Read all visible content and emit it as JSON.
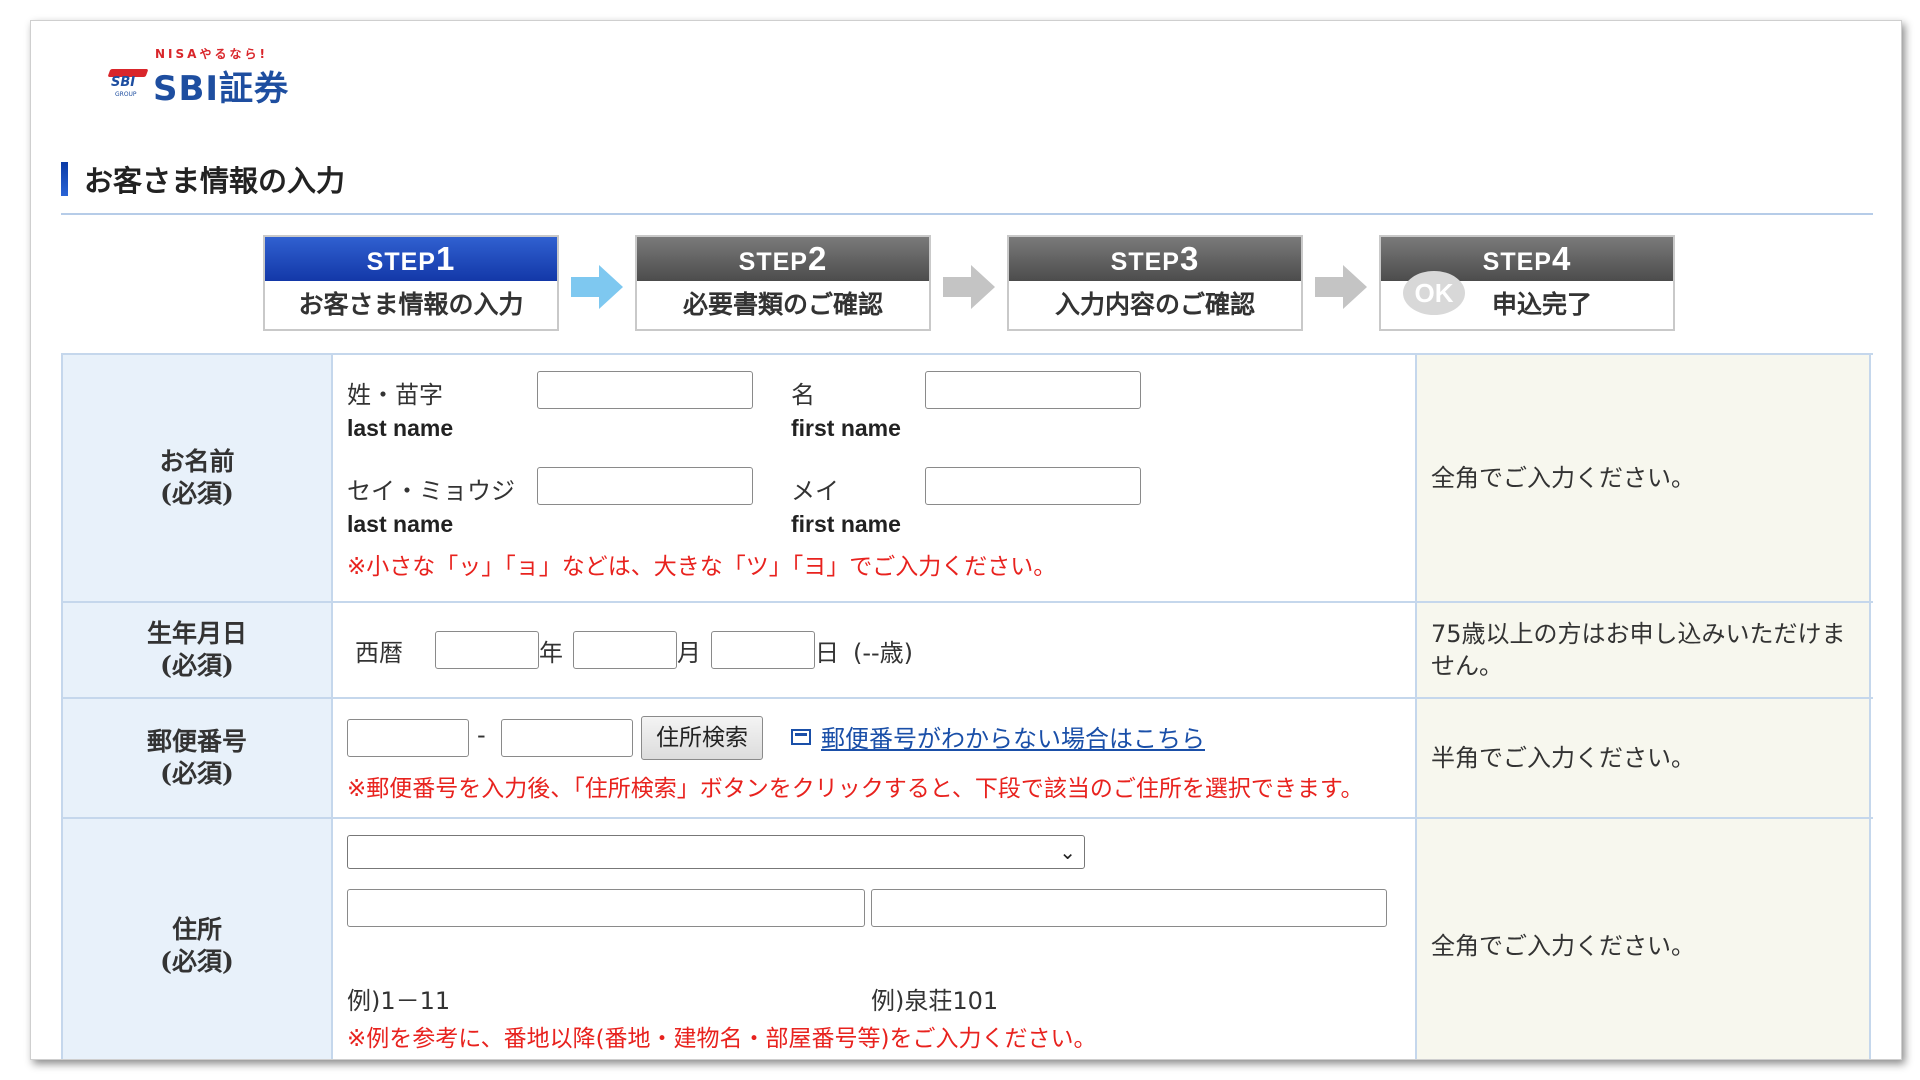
{
  "logo": {
    "tagline": "NISAやるなら!",
    "mark_text": "SBI",
    "group_text": "GROUP",
    "name": "SBI証券"
  },
  "section": {
    "title": "お客さま情報の入力"
  },
  "steps": [
    {
      "prefix": "STEP",
      "num": "1",
      "label": "お客さま情報の入力",
      "active": true
    },
    {
      "prefix": "STEP",
      "num": "2",
      "label": "必要書類のご確認",
      "active": false
    },
    {
      "prefix": "STEP",
      "num": "3",
      "label": "入力内容のご確認",
      "active": false
    },
    {
      "prefix": "STEP",
      "num": "4",
      "label": "申込完了",
      "active": false,
      "badge": "OK"
    }
  ],
  "colors": {
    "accent_blue": "#1338a8",
    "arrow_active": "#7ec8f0",
    "arrow_inactive": "#c4c4c4",
    "note_red": "#e8221e",
    "link": "#1a4fa8"
  },
  "form": {
    "name": {
      "header": "お名前",
      "required": "(必須)",
      "last_kanji_label": "姓・苗字",
      "first_kanji_label": "名",
      "last_en": "last name",
      "first_en": "first name",
      "last_kana_label": "セイ・ミョウジ",
      "first_kana_label": "メイ",
      "note": "※小さな「ッ」「ョ」などは、大きな「ツ」「ヨ」でご入力ください。",
      "hint": "全角でご入力ください。",
      "values": {
        "last_kanji": "",
        "first_kanji": "",
        "last_kana": "",
        "first_kana": ""
      }
    },
    "birth": {
      "header": "生年月日",
      "required": "(必須)",
      "era": "西暦",
      "year": "年",
      "month": "月",
      "day": "日",
      "age": "(--歳)",
      "hint": "75歳以上の方はお申し込みいただけません。",
      "values": {
        "year": "",
        "month": "",
        "day": ""
      }
    },
    "postal": {
      "header": "郵便番号",
      "required": "(必須)",
      "dash": "-",
      "search_button": "住所検索",
      "link": "郵便番号がわからない場合はこちら",
      "note": "※郵便番号を入力後、「住所検索」ボタンをクリックすると、下段で該当のご住所を選択できます。",
      "hint": "半角でご入力ください。",
      "values": {
        "first": "",
        "second": ""
      }
    },
    "address": {
      "header": "住所",
      "required": "(必須)",
      "selected": "",
      "example1": "例)1－11",
      "example2": "例)泉荘101",
      "note": "※例を参考に、番地以降(番地・建物名・部屋番号等)をご入力ください。",
      "hint": "全角でご入力ください。",
      "values": {
        "line1": "",
        "line2": ""
      }
    }
  }
}
